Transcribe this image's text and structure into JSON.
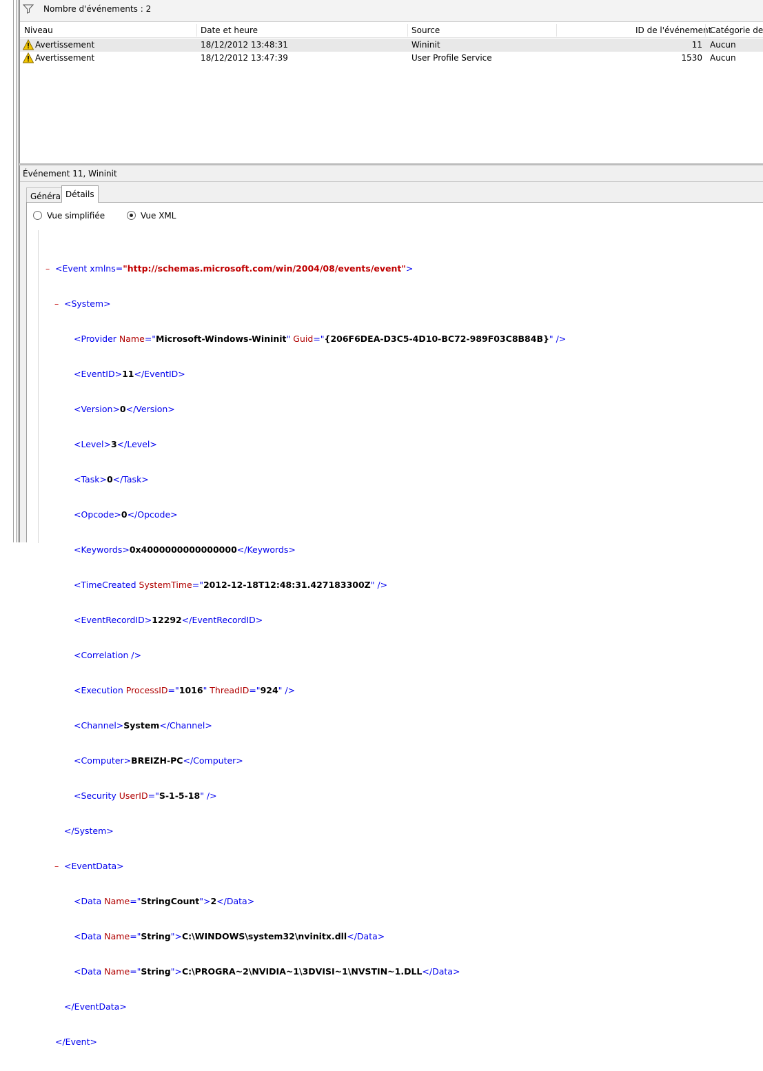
{
  "filter": {
    "label": "Nombre d'événements : 2"
  },
  "columns": [
    "Niveau",
    "Date et heure",
    "Source",
    "ID de l'événement",
    "Catégorie de la"
  ],
  "events": [
    {
      "level": "Avertissement",
      "datetime": "18/12/2012 13:48:31",
      "source": "Wininit",
      "event_id": "11",
      "category": "Aucun"
    },
    {
      "level": "Avertissement",
      "datetime": "18/12/2012 13:47:39",
      "source": "User Profile Service",
      "event_id": "1530",
      "category": "Aucun"
    }
  ],
  "detail": {
    "title": "Événement 11, Wininit",
    "tabs": [
      "Général",
      "Détails"
    ],
    "active_tab": "Détails",
    "views": [
      "Vue simplifiée",
      "Vue XML"
    ],
    "selected_view": "Vue XML"
  },
  "xml": {
    "event_open": "<Event xmlns=",
    "event_ns": "\"http://schemas.microsoft.com/win/2004/08/events/event\"",
    "system_open": "<System>",
    "provider_name": "Microsoft-Windows-Wininit",
    "provider_guid": "{206F6DEA-D3C5-4D10-BC72-989F03C8B84B}",
    "event_id": "11",
    "version": "0",
    "level": "3",
    "task": "0",
    "opcode": "0",
    "keywords": "0x4000000000000000",
    "system_time": "2012-12-18T12:48:31.427183300Z",
    "event_record_id": "12292",
    "process_id": "1016",
    "thread_id": "924",
    "channel": "System",
    "computer": "BREIZH-PC",
    "user_id": "S-1-5-18",
    "data1_name": "StringCount",
    "data1_value": "2",
    "data2_name": "String",
    "data2_value": "C:\\WINDOWS\\system32\\nvinitx.dll",
    "data3_name": "String",
    "data3_value": "C:\\PROGRA~2\\NVIDIA~1\\3DVISI~1\\NVSTIN~1.DLL"
  },
  "colors": {
    "tag": "#0000ee",
    "attr_name": "#b00000",
    "namespace": "#c00000",
    "selection": "#e8e8e8"
  }
}
